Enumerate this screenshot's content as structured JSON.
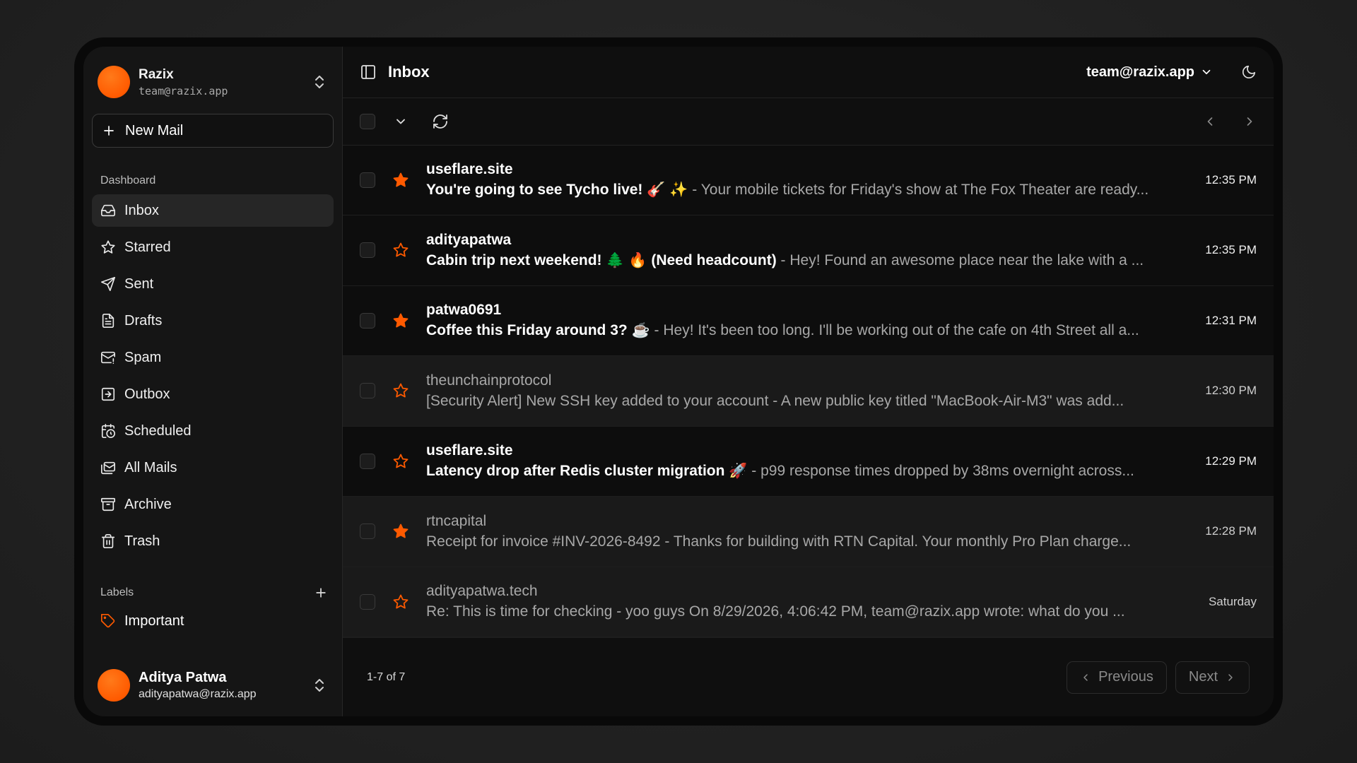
{
  "account": {
    "name": "Razix",
    "email": "team@razix.app"
  },
  "sidebar": {
    "new_mail_label": "New Mail",
    "section_label": "Dashboard",
    "items": [
      {
        "label": "Inbox",
        "icon": "inbox-icon",
        "active": true
      },
      {
        "label": "Starred",
        "icon": "star-icon"
      },
      {
        "label": "Sent",
        "icon": "send-icon"
      },
      {
        "label": "Drafts",
        "icon": "file-text-icon"
      },
      {
        "label": "Spam",
        "icon": "mail-warning-icon"
      },
      {
        "label": "Outbox",
        "icon": "outbox-icon"
      },
      {
        "label": "Scheduled",
        "icon": "calendar-clock-icon"
      },
      {
        "label": "All Mails",
        "icon": "mails-icon"
      },
      {
        "label": "Archive",
        "icon": "archive-icon"
      },
      {
        "label": "Trash",
        "icon": "trash-icon"
      }
    ],
    "labels_title": "Labels",
    "labels": [
      {
        "label": "Important",
        "icon": "tag-icon"
      }
    ]
  },
  "user": {
    "name": "Aditya Patwa",
    "email": "adityapatwa@razix.app"
  },
  "header": {
    "title": "Inbox",
    "account_selector": "team@razix.app"
  },
  "emails": [
    {
      "sender": "useflare.site",
      "subject": "You're going to see Tycho live! 🎸 ✨",
      "snippet": " - Your mobile tickets for Friday's show at The Fox Theater are ready...",
      "time": "12:35 PM",
      "starred": true,
      "unread": true
    },
    {
      "sender": "adityapatwa",
      "subject": "Cabin trip next weekend! 🌲 🔥 (Need headcount)",
      "snippet": " - Hey! Found an awesome place near the lake with a ...",
      "time": "12:35 PM",
      "starred": false,
      "unread": true
    },
    {
      "sender": "patwa0691",
      "subject": "Coffee this Friday around 3? ☕",
      "snippet": " - Hey! It's been too long. I'll be working out of the cafe on 4th Street all a...",
      "time": "12:31 PM",
      "starred": true,
      "unread": true
    },
    {
      "sender": "theunchainprotocol",
      "subject": "[Security Alert] New SSH key added to your account",
      "snippet": " - A new public key titled \"MacBook-Air-M3\" was add...",
      "time": "12:30 PM",
      "starred": false,
      "unread": false
    },
    {
      "sender": "useflare.site",
      "subject": "Latency drop after Redis cluster migration 🚀",
      "snippet": " - p99 response times dropped by 38ms overnight across...",
      "time": "12:29 PM",
      "starred": false,
      "unread": true
    },
    {
      "sender": "rtncapital",
      "subject": "Receipt for invoice #INV-2026-8492",
      "snippet": " - Thanks for building with RTN Capital. Your monthly Pro Plan charge...",
      "time": "12:28 PM",
      "starred": true,
      "unread": false
    },
    {
      "sender": "adityapatwa.tech",
      "subject": "Re: This is time for checking",
      "snippet": " - yoo guys On 8/29/2026, 4:06:42 PM, team@razix.app wrote: what do you ...",
      "time": "Saturday",
      "starred": false,
      "unread": false
    }
  ],
  "pagination": {
    "count": "1-7 of 7",
    "previous": "Previous",
    "next": "Next"
  },
  "colors": {
    "accent": "#ff5a00",
    "star_filled": "#ff5a00",
    "star_outline": "#ff5a00"
  }
}
